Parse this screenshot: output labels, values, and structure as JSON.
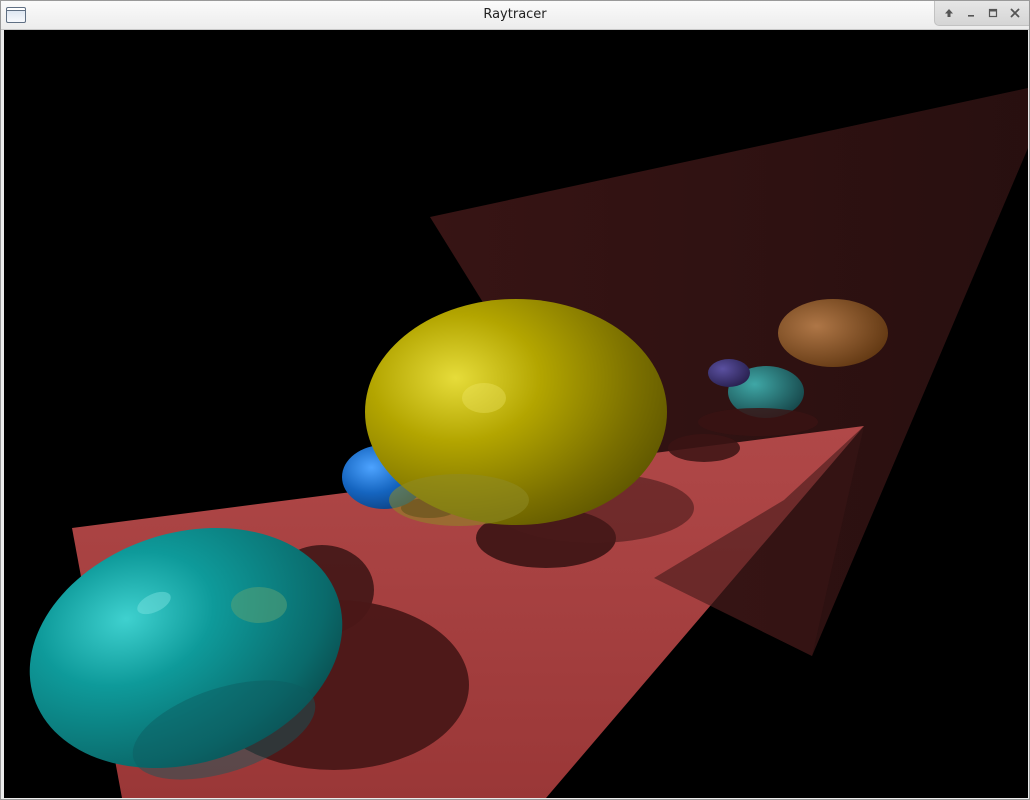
{
  "window": {
    "title": "Raytracer",
    "app_icon": "window-icon",
    "controls": [
      {
        "name": "shade-button",
        "icon": "arrow-up-icon"
      },
      {
        "name": "minimize-button",
        "icon": "minimize-icon"
      },
      {
        "name": "maximize-button",
        "icon": "maximize-icon"
      },
      {
        "name": "close-button",
        "icon": "close-icon"
      }
    ]
  },
  "scene": {
    "background": "#000000",
    "floor_color": "#9c3a3a",
    "wall_color": "#4a1e1e",
    "objects": [
      {
        "name": "cyan-sphere",
        "color": "#0b8d8d"
      },
      {
        "name": "yellow-sphere",
        "color": "#a9a000"
      },
      {
        "name": "blue-sphere",
        "color": "#1565c0"
      },
      {
        "name": "small-cyan-sphere",
        "color": "#1f6f70"
      },
      {
        "name": "small-purple-sphere",
        "color": "#3a2f73"
      },
      {
        "name": "orange-reflection-sphere",
        "color": "#a56a25"
      }
    ]
  }
}
